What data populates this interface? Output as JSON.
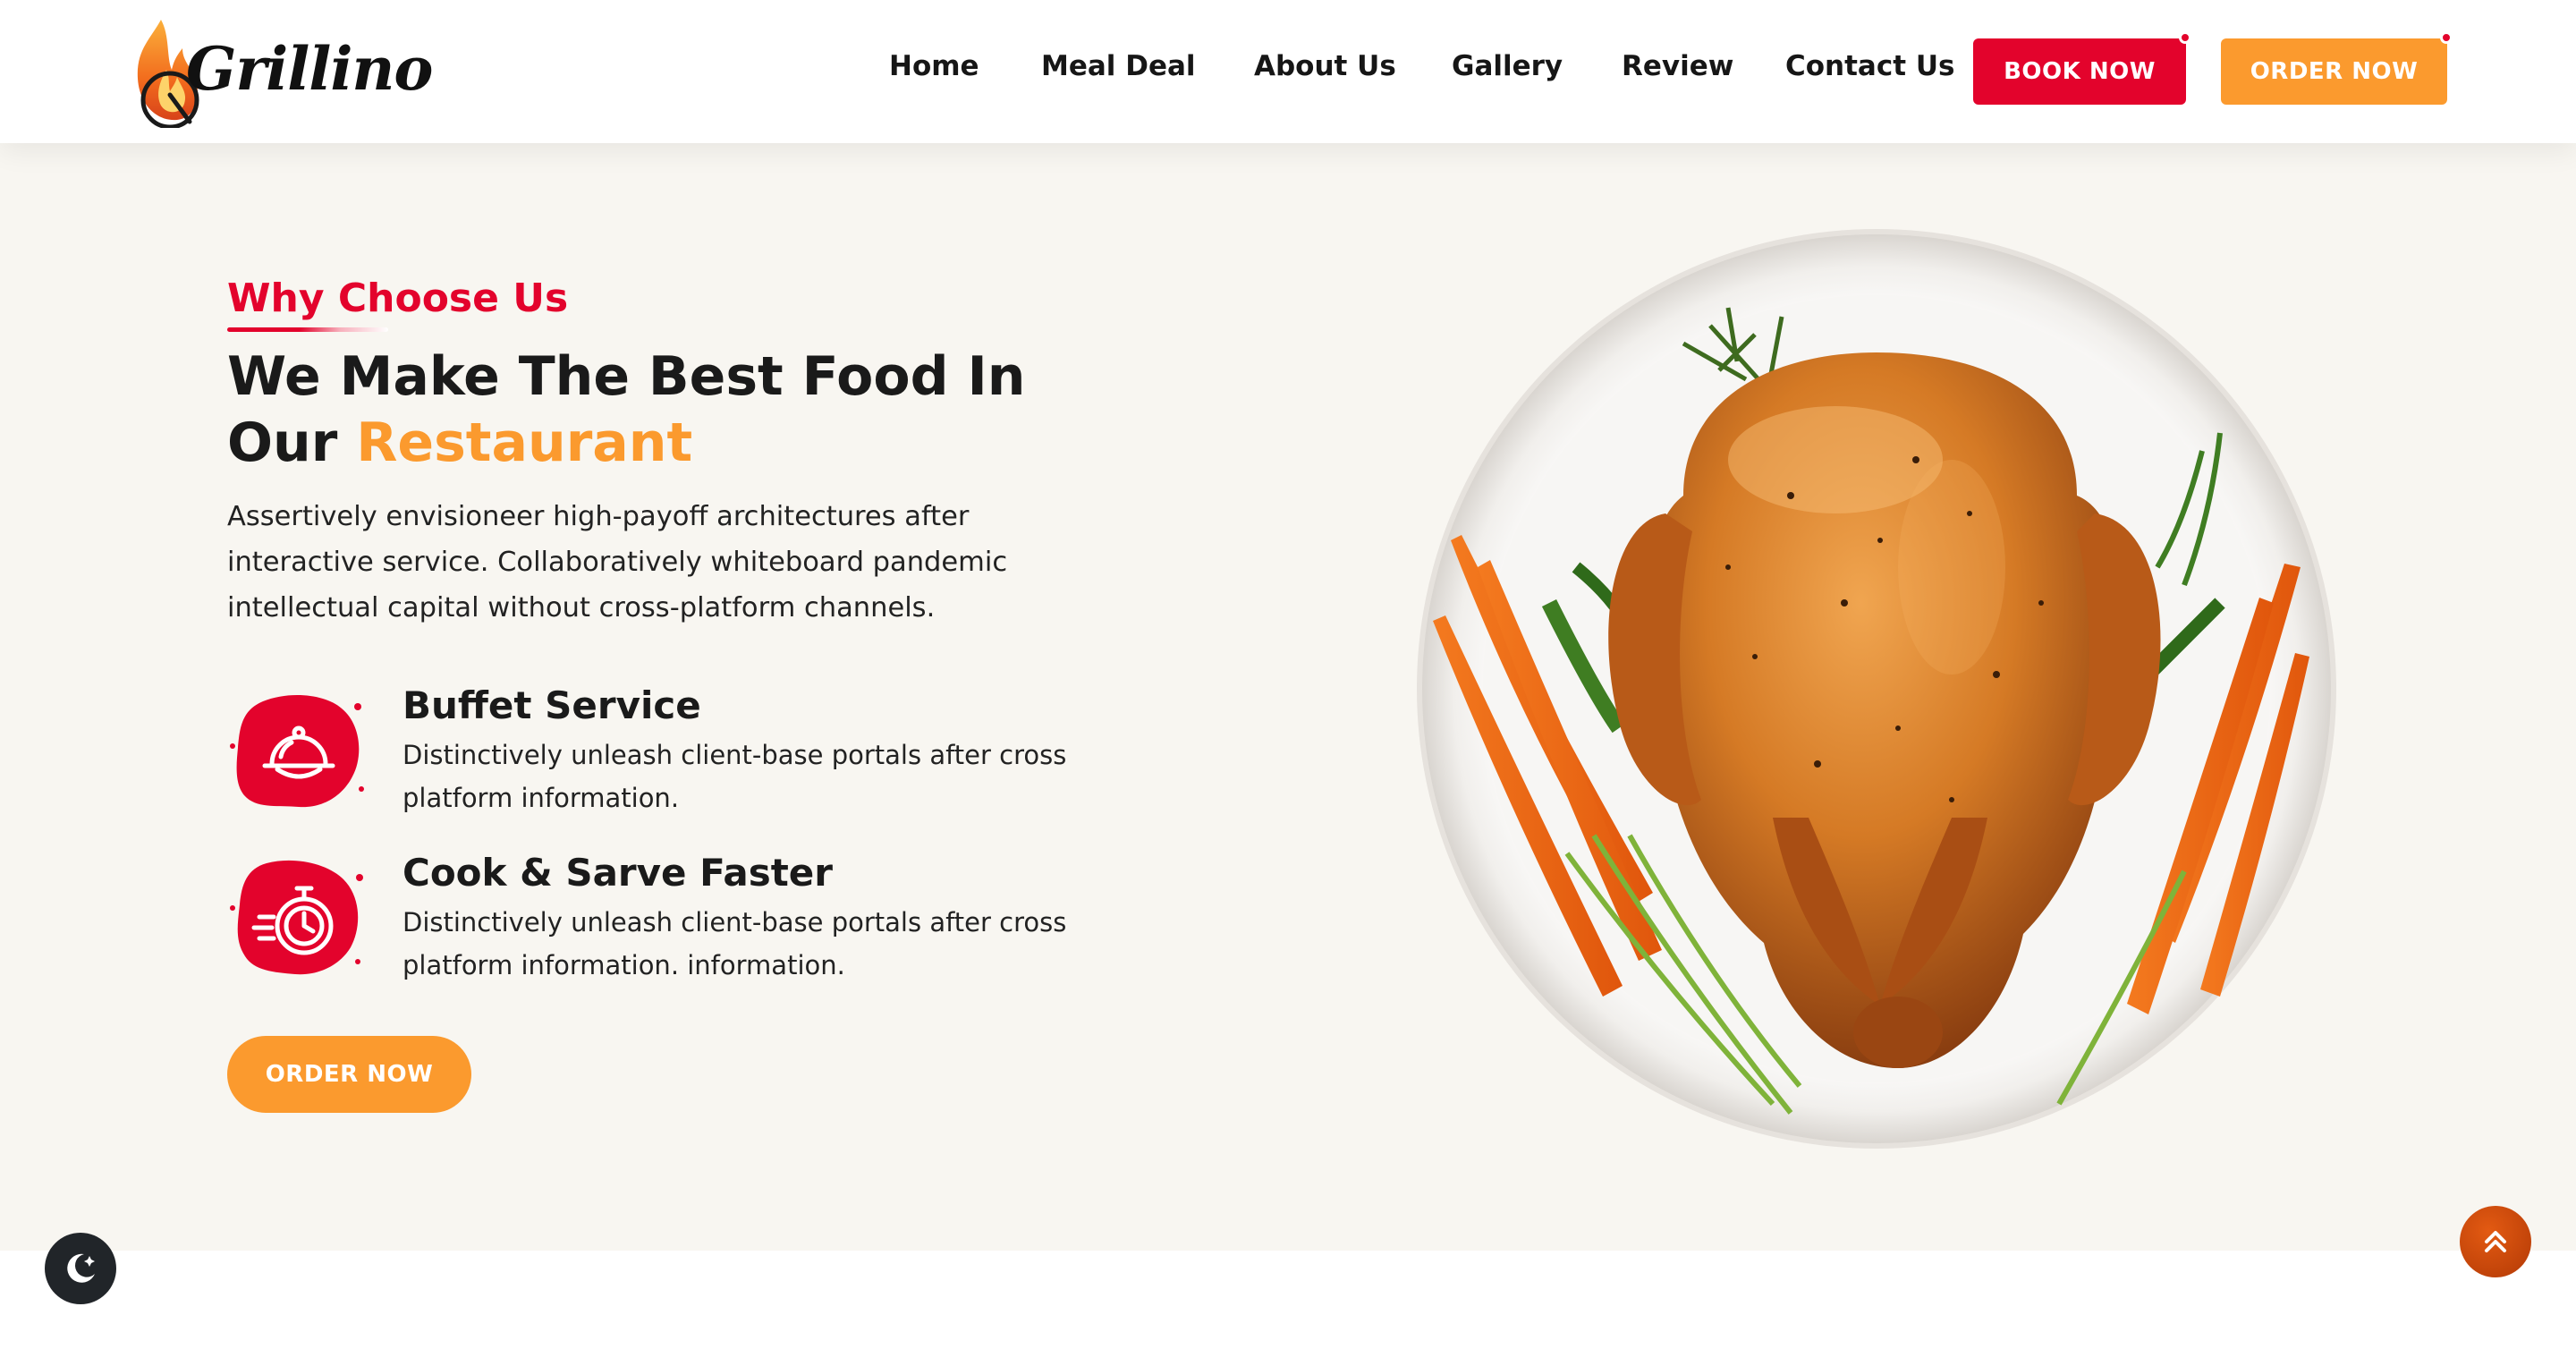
{
  "brand": {
    "name": "Grillino",
    "logo_icon": "flame-fork-icon"
  },
  "nav": {
    "items": [
      {
        "label": "Home"
      },
      {
        "label": "Meal Deal"
      },
      {
        "label": "About Us"
      },
      {
        "label": "Gallery"
      },
      {
        "label": "Review"
      },
      {
        "label": "Contact Us"
      }
    ],
    "book_label": "BOOK NOW",
    "order_label": "ORDER NOW"
  },
  "section": {
    "eyebrow": "Why Choose Us",
    "headline_line1": "We Make The Best Food In",
    "headline_line2_prefix": "Our ",
    "headline_accent": "Restaurant",
    "lead": "Assertively envisioneer high-payoff architectures after interactive service. Collaboratively whiteboard pandemic intellectual capital without cross-platform channels.",
    "features": [
      {
        "title": "Buffet Service",
        "desc": "Distinctively unleash client-base portals after cross platform information.",
        "icon": "cloche-icon"
      },
      {
        "title": "Cook & Sarve Faster",
        "desc": "Distinctively unleash client-base portals after cross platform information. information.",
        "icon": "stopwatch-icon"
      }
    ],
    "cta_label": "ORDER NOW",
    "image": "roast-chicken-plate"
  },
  "floating": {
    "dark_mode_icon": "moon-stars-icon",
    "scroll_top_icon": "double-chevron-up-icon"
  },
  "colors": {
    "primary_red": "#e3032c",
    "accent_orange": "#fb9a2e",
    "section_bg": "#f8f6f1",
    "dark": "#212529"
  }
}
